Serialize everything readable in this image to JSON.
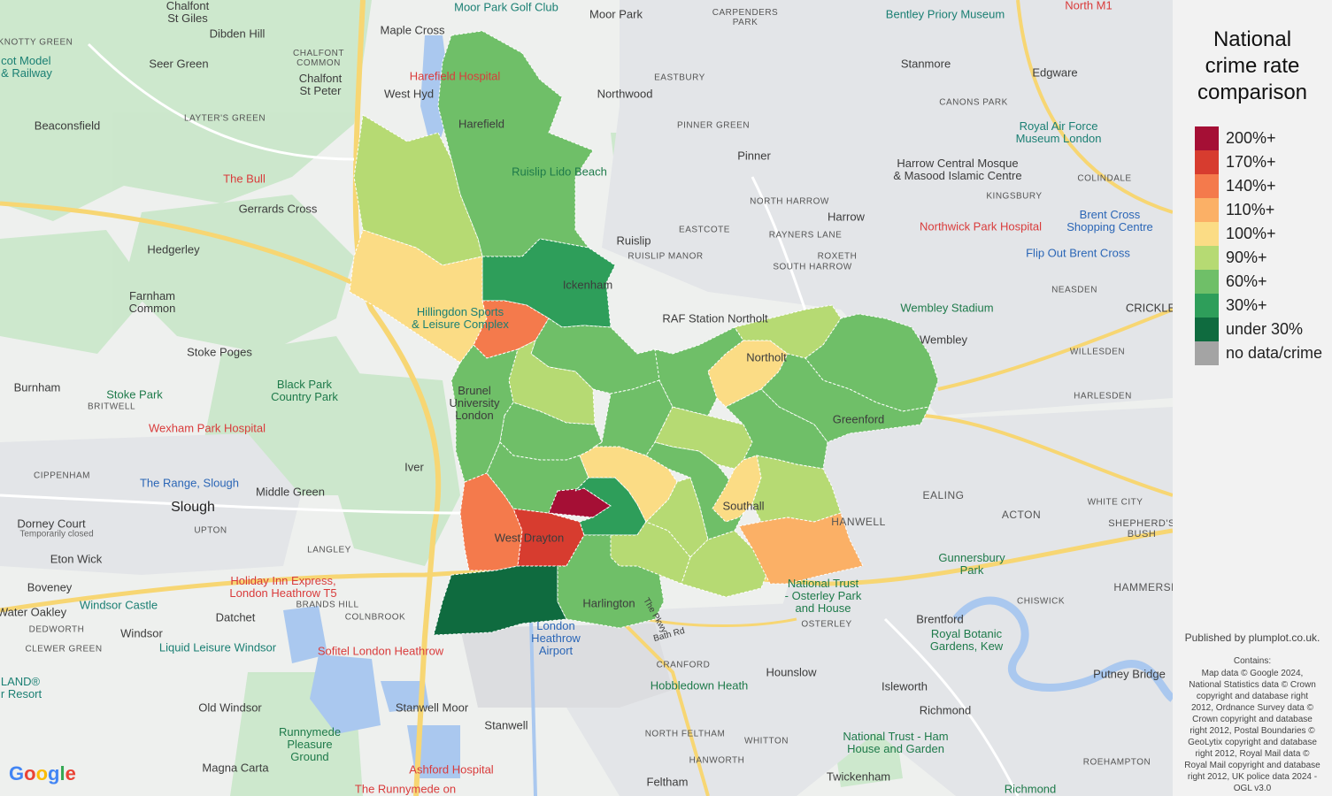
{
  "legend": {
    "title_lines": [
      "National",
      "crime rate",
      "comparison"
    ],
    "items": [
      {
        "label": "200%+",
        "color": "#a50f35"
      },
      {
        "label": "170%+",
        "color": "#d73c2f"
      },
      {
        "label": "140%+",
        "color": "#f47a4c"
      },
      {
        "label": "110%+",
        "color": "#fbb066"
      },
      {
        "label": "100%+",
        "color": "#fbdc85"
      },
      {
        "label": "90%+",
        "color": "#b6da73"
      },
      {
        "label": "60%+",
        "color": "#6fbf68"
      },
      {
        "label": "30%+",
        "color": "#2e9e5a"
      },
      {
        "label": "under 30%",
        "color": "#0f6b3f"
      },
      {
        "label": "no data/crime",
        "color": "#a4a4a4"
      }
    ]
  },
  "credits": {
    "published": "Published by plumplot.co.uk.",
    "contains_title": "Contains:",
    "contains_lines": [
      "Map data © Google 2024,",
      "National Statistics data © Crown",
      "copyright and database right",
      "2012, Ordnance Survey data ©",
      "Crown copyright and database",
      "right 2012, Postal Boundaries ©",
      "GeoLytix copyright and database",
      "right 2012, Royal Mail data ©",
      "Royal Mail copyright and database",
      "right 2012, UK police data 2024 -",
      "OGL v3.0"
    ]
  },
  "google_logo": "Google",
  "map_labels": {
    "chalfont_st_giles": "Chalfont\nSt Giles",
    "knotty_green": "KNOTTY GREEN",
    "dibden_hill": "Dibden Hill",
    "seer_green": "Seer Green",
    "chalfont_common": "CHALFONT\nCOMMON",
    "maple_cross": "Maple Cross",
    "moor_park_golf": "Moor Park Golf Club",
    "moor_park": "Moor Park",
    "carpenders_park": "CARPENDERS\nPARK",
    "bentley_priory": "Bentley Priory Museum",
    "north_m1": "North M1",
    "bekonscot": "cot Model\n& Railway",
    "chalfont_st_peter": "Chalfont\nSt Peter",
    "harefield_hospital": "Harefield Hospital",
    "west_hyde": "West Hyd",
    "eastbury": "EASTBURY",
    "stanmore": "Stanmore",
    "edgware": "Edgware",
    "beaconsfield": "Beaconsfield",
    "layters_green": "LAYTER'S GREEN",
    "northwood": "Northwood",
    "harefield": "Harefield",
    "pinner_green": "PINNER GREEN",
    "canons_park": "CANONS PARK",
    "raf_museum": "Royal Air Force\nMuseum London",
    "pinner": "Pinner",
    "the_bull": "The Bull",
    "ruislip_lido": "Ruislip Lido Beach",
    "harrow_mosque": "Harrow Central Mosque\n& Masood Islamic Centre",
    "kingsbury": "KINGSBURY",
    "colindale": "COLINDALE",
    "gerrards_cross": "Gerrards Cross",
    "north_harrow": "NORTH HARROW",
    "harrow": "Harrow",
    "northwick_park": "Northwick Park Hospital",
    "brent_cross": "Brent Cross\nShopping Centre",
    "hedgerley": "Hedgerley",
    "eastcote": "EASTCOTE",
    "rayners_lane": "RAYNERS LANE",
    "ruislip": "Ruislip",
    "ruislip_manor": "RUISLIP MANOR",
    "roxeth": "ROXETH",
    "south_harrow": "SOUTH HARROW",
    "flip_out": "Flip Out Brent Cross",
    "farnham_common": "Farnham\nCommon",
    "ickenham": "Ickenham",
    "neasden": "NEASDEN",
    "raf_northolt": "RAF Station Northolt",
    "wembley_stadium": "Wembley Stadium",
    "crickle": "CRICKLE",
    "hillingdon_sports": "Hillingdon Sports\n& Leisure Complex",
    "wembley": "Wembley",
    "stoke_poges": "Stoke Poges",
    "northolt": "Northolt",
    "willesden": "WILLESDEN",
    "burnham": "Burnham",
    "stoke_park": "Stoke Park",
    "black_park": "Black Park\nCountry Park",
    "brunel_uni": "Brunel\nUniversity\nLondon",
    "harlesden": "HARLESDEN",
    "britwell": "BRITWELL",
    "wexham": "Wexham Park Hospital",
    "greenford": "Greenford",
    "iver": "Iver",
    "cippenham": "CIPPENHAM",
    "the_range": "The Range, Slough",
    "middle_green": "Middle Green",
    "ealing": "EALING",
    "slough": "Slough",
    "acton": "ACTON",
    "white_city": "WHITE CITY",
    "hanwell": "HANWELL",
    "dorney_court": "Dorney Court",
    "temporarily_closed": "Temporarily closed",
    "upton": "UPTON",
    "west_drayton": "West Drayton",
    "southall": "Southall",
    "shepherds_bush": "SHEPHERD'S\nBUSH",
    "eton_wick": "Eton Wick",
    "langley": "LANGLEY",
    "gunnersbury": "Gunnersbury\nPark",
    "boveney": "Boveney",
    "holiday_inn": "Holiday Inn Express,\nLondon Heathrow T5",
    "national_trust_osterley": "National Trust\n- Osterley Park\nand House",
    "hammersmith": "HAMMERSM",
    "brands_hill": "BRANDS HILL",
    "water_oakley": "Water Oakley",
    "colnbrook": "COLNBROOK",
    "harlington": "Harlington",
    "chiswick": "CHISWICK",
    "windsor_castle": "Windsor Castle",
    "datchet": "Datchet",
    "osterley": "OSTERLEY",
    "brentford": "Brentford",
    "dedworth": "DEDWORTH",
    "windsor": "Windsor",
    "heathrow": "London\nHeathrow\nAirport",
    "royal_botanic": "Royal Botanic\nGardens, Kew",
    "clewer_green": "CLEWER GREEN",
    "liquid_leisure": "Liquid Leisure Windsor",
    "sofitel": "Sofitel London Heathrow",
    "cranford": "CRANFORD",
    "hounslow": "Hounslow",
    "putney_bridge": "Putney Bridge",
    "legoland": "LAND®\nr Resort",
    "hobbledown": "Hobbledown Heath",
    "isleworth": "Isleworth",
    "old_windsor": "Old Windsor",
    "stanwell_moor": "Stanwell Moor",
    "richmond": "Richmond",
    "stanwell": "Stanwell",
    "north_feltham": "NORTH FELTHAM",
    "whitton": "WHITTON",
    "national_trust_ham": "National Trust - Ham\nHouse and Garden",
    "roehampton": "ROEHAMPTON",
    "runnymede": "Runnymede\nPleasure\nGround",
    "magna_carta": "Magna Carta",
    "ashford_hospital": "Ashford Hospital",
    "hanworth": "HANWORTH",
    "the_runnymede": "The Runnymede on",
    "feltham": "Feltham",
    "twickenham": "Twickenham",
    "richmond_park": "Richmond",
    "bath_rd": "Bath Rd",
    "the_pkwy": "The Pkwy"
  }
}
